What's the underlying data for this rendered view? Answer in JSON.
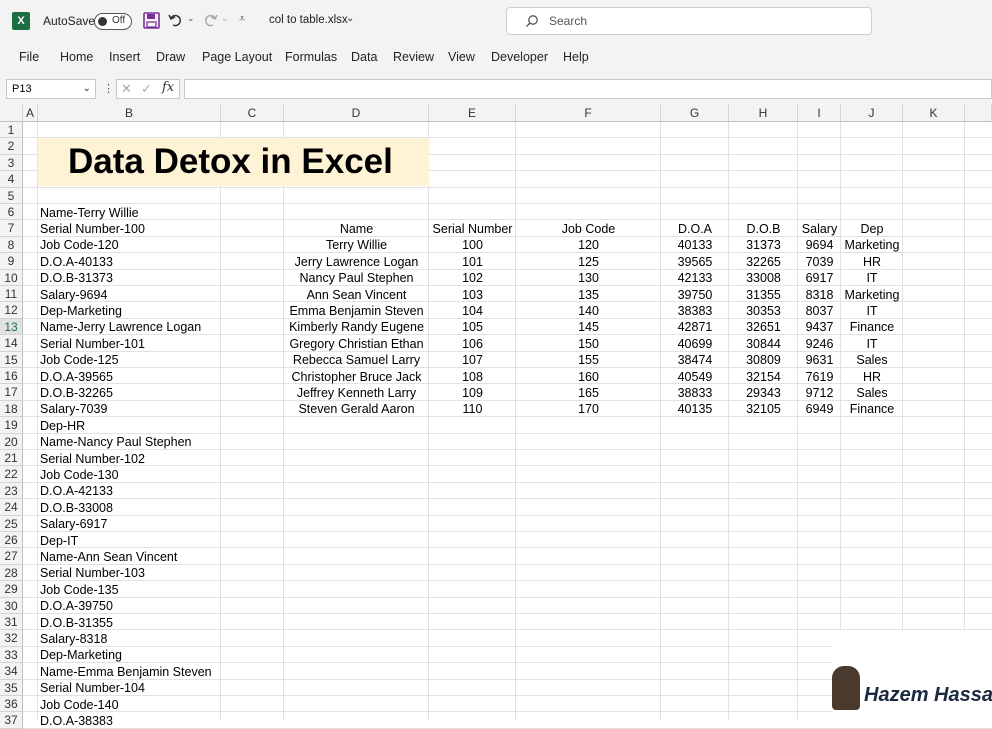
{
  "titlebar": {
    "autosave_label": "AutoSave",
    "autosave_state": "Off",
    "filename": "col to table.xlsx",
    "search_placeholder": "Search"
  },
  "menu": [
    "File",
    "Home",
    "Insert",
    "Draw",
    "Page Layout",
    "Formulas",
    "Data",
    "Review",
    "View",
    "Developer",
    "Help"
  ],
  "formula_bar": {
    "name_box": "P13",
    "value": ""
  },
  "columns": [
    "A",
    "B",
    "C",
    "D",
    "E",
    "F",
    "G",
    "H",
    "I",
    "J",
    "K"
  ],
  "selected_row": 13,
  "title_text": "Data Detox in Excel",
  "col_b_values": [
    "Name-Terry Willie",
    "Serial Number-100",
    "Job Code-120",
    "D.O.A-40133",
    "D.O.B-31373",
    "Salary-9694",
    "Dep-Marketing",
    "Name-Jerry Lawrence Logan",
    "Serial Number-101",
    "Job Code-125",
    "D.O.A-39565",
    "D.O.B-32265",
    "Salary-7039",
    "Dep-HR",
    "Name-Nancy Paul Stephen",
    "Serial Number-102",
    "Job Code-130",
    "D.O.A-42133",
    "D.O.B-33008",
    "Salary-6917",
    "Dep-IT",
    "Name-Ann Sean Vincent",
    "Serial Number-103",
    "Job Code-135",
    "D.O.A-39750",
    "D.O.B-31355",
    "Salary-8318",
    "Dep-Marketing",
    "Name-Emma Benjamin Steven",
    "Serial Number-104",
    "Job Code-140",
    "D.O.A-38383"
  ],
  "table": {
    "headers": [
      "Name",
      "Serial Number",
      "Job Code",
      "D.O.A",
      "D.O.B",
      "Salary",
      "Dep"
    ],
    "rows": [
      [
        "Terry Willie",
        "100",
        "120",
        "40133",
        "31373",
        "9694",
        "Marketing"
      ],
      [
        "Jerry Lawrence Logan",
        "101",
        "125",
        "39565",
        "32265",
        "7039",
        "HR"
      ],
      [
        "Nancy Paul Stephen",
        "102",
        "130",
        "42133",
        "33008",
        "6917",
        "IT"
      ],
      [
        "Ann Sean Vincent",
        "103",
        "135",
        "39750",
        "31355",
        "8318",
        "Marketing"
      ],
      [
        "Emma Benjamin Steven",
        "104",
        "140",
        "38383",
        "30353",
        "8037",
        "IT"
      ],
      [
        "Kimberly Randy Eugene",
        "105",
        "145",
        "42871",
        "32651",
        "9437",
        "Finance"
      ],
      [
        "Gregory Christian Ethan",
        "106",
        "150",
        "40699",
        "30844",
        "9246",
        "IT"
      ],
      [
        "Rebecca Samuel Larry",
        "107",
        "155",
        "38474",
        "30809",
        "9631",
        "Sales"
      ],
      [
        "Christopher Bruce Jack",
        "108",
        "160",
        "40549",
        "32154",
        "7619",
        "HR"
      ],
      [
        "Jeffrey Kenneth Larry",
        "109",
        "165",
        "38833",
        "29343",
        "9712",
        "Sales"
      ],
      [
        "Steven Gerald Aaron",
        "110",
        "170",
        "40135",
        "32105",
        "6949",
        "Finance"
      ]
    ]
  },
  "watermark_text": "Hazem Hassan"
}
